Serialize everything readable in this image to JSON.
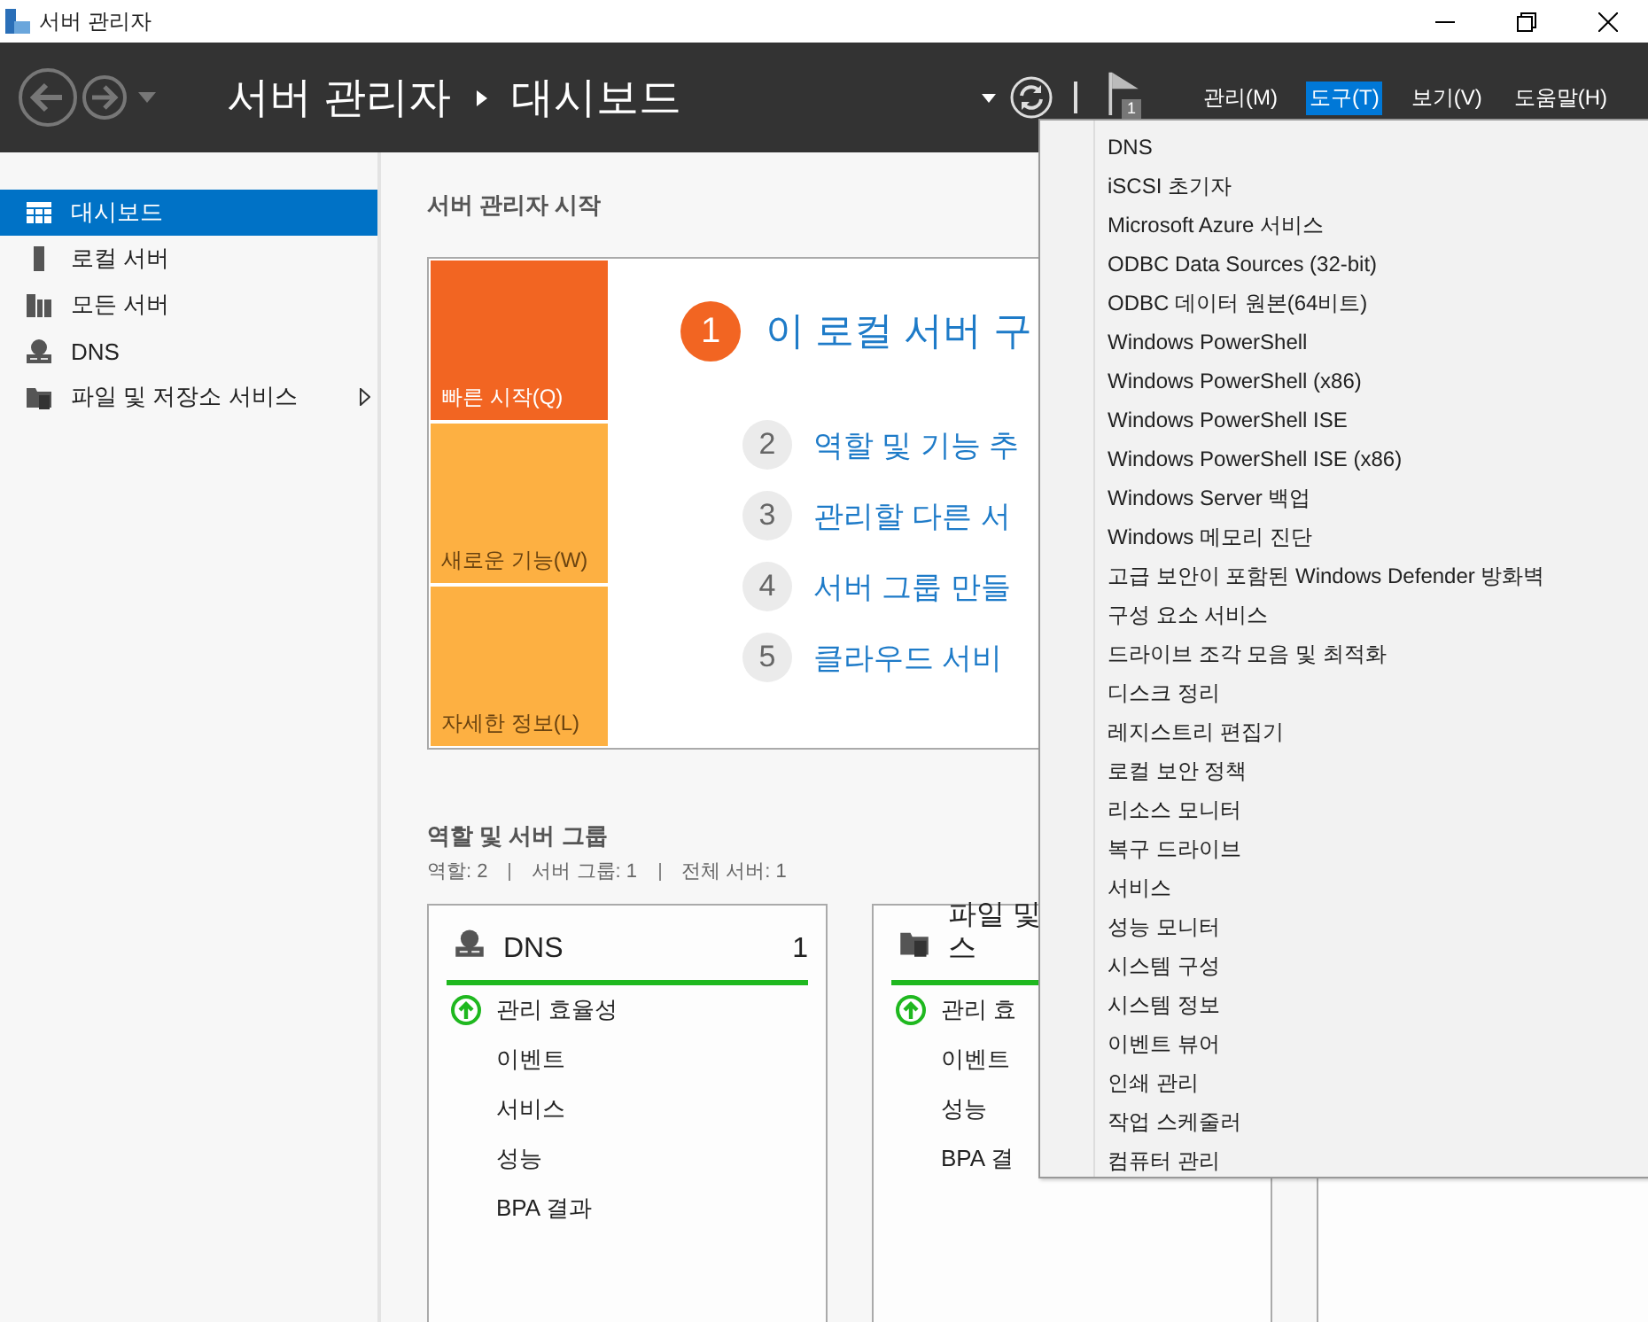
{
  "window": {
    "title": "서버 관리자"
  },
  "header": {
    "breadcrumb": [
      "서버 관리자",
      "대시보드"
    ],
    "notification_count": "1",
    "menus": [
      {
        "label": "관리(M)",
        "selected": false
      },
      {
        "label": "도구(T)",
        "selected": true
      },
      {
        "label": "보기(V)",
        "selected": false
      },
      {
        "label": "도움말(H)",
        "selected": false
      }
    ]
  },
  "sidebar": {
    "items": [
      {
        "label": "대시보드",
        "selected": true,
        "expandable": false
      },
      {
        "label": "로컬 서버",
        "selected": false,
        "expandable": false
      },
      {
        "label": "모든 서버",
        "selected": false,
        "expandable": false
      },
      {
        "label": "DNS",
        "selected": false,
        "expandable": false
      },
      {
        "label": "파일 및 저장소 서비스",
        "selected": false,
        "expandable": true
      }
    ]
  },
  "quick_start": {
    "title": "서버 관리자 시작",
    "tiles": [
      {
        "label": "빠른 시작(Q)",
        "selected": true
      },
      {
        "label": "새로운 기능(W)",
        "selected": false
      },
      {
        "label": "자세한 정보(L)",
        "selected": false
      }
    ],
    "steps": [
      {
        "number": "1",
        "label": "이 로컬 서버 구",
        "primary": true
      },
      {
        "number": "2",
        "label": "역할 및 기능 추",
        "primary": false
      },
      {
        "number": "3",
        "label": "관리할 다른 서",
        "primary": false
      },
      {
        "number": "4",
        "label": "서버 그룹 만들",
        "primary": false
      },
      {
        "number": "5",
        "label": "클라우드 서비",
        "primary": false
      }
    ]
  },
  "roles": {
    "title": "역할 및 서버 그룹",
    "counts": [
      "역할: 2",
      "서버 그룹: 1",
      "전체 서버: 1"
    ],
    "cards": [
      {
        "title": [
          "DNS"
        ],
        "count": "1",
        "rows": [
          {
            "label": "관리 효율성",
            "status_ok": true
          },
          {
            "label": "이벤트",
            "status_ok": false
          },
          {
            "label": "서비스",
            "status_ok": false
          },
          {
            "label": "성능",
            "status_ok": false
          },
          {
            "label": "BPA 결과",
            "status_ok": false
          }
        ]
      },
      {
        "title": [
          "파일 및",
          "스"
        ],
        "rows": [
          {
            "label": "관리 효",
            "status_ok": true
          },
          {
            "label": "이벤트",
            "status_ok": false
          },
          {
            "label": "성능",
            "status_ok": false
          },
          {
            "label": "BPA 결",
            "status_ok": false
          }
        ]
      }
    ]
  },
  "tools_menu": {
    "items": [
      "DNS",
      "iSCSI 초기자",
      "Microsoft Azure 서비스",
      "ODBC Data Sources (32-bit)",
      "ODBC 데이터 원본(64비트)",
      "Windows PowerShell",
      "Windows PowerShell (x86)",
      "Windows PowerShell ISE",
      "Windows PowerShell ISE (x86)",
      "Windows Server 백업",
      "Windows 메모리 진단",
      "고급 보안이 포함된 Windows Defender 방화벽",
      "구성 요소 서비스",
      "드라이브 조각 모음 및 최적화",
      "디스크 정리",
      "레지스트리 편집기",
      "로컬 보안 정책",
      "리소스 모니터",
      "복구 드라이브",
      "서비스",
      "성능 모니터",
      "시스템 구성",
      "시스템 정보",
      "이벤트 뷰어",
      "인쇄 관리",
      "작업 스케줄러",
      "컴퓨터 관리"
    ]
  }
}
